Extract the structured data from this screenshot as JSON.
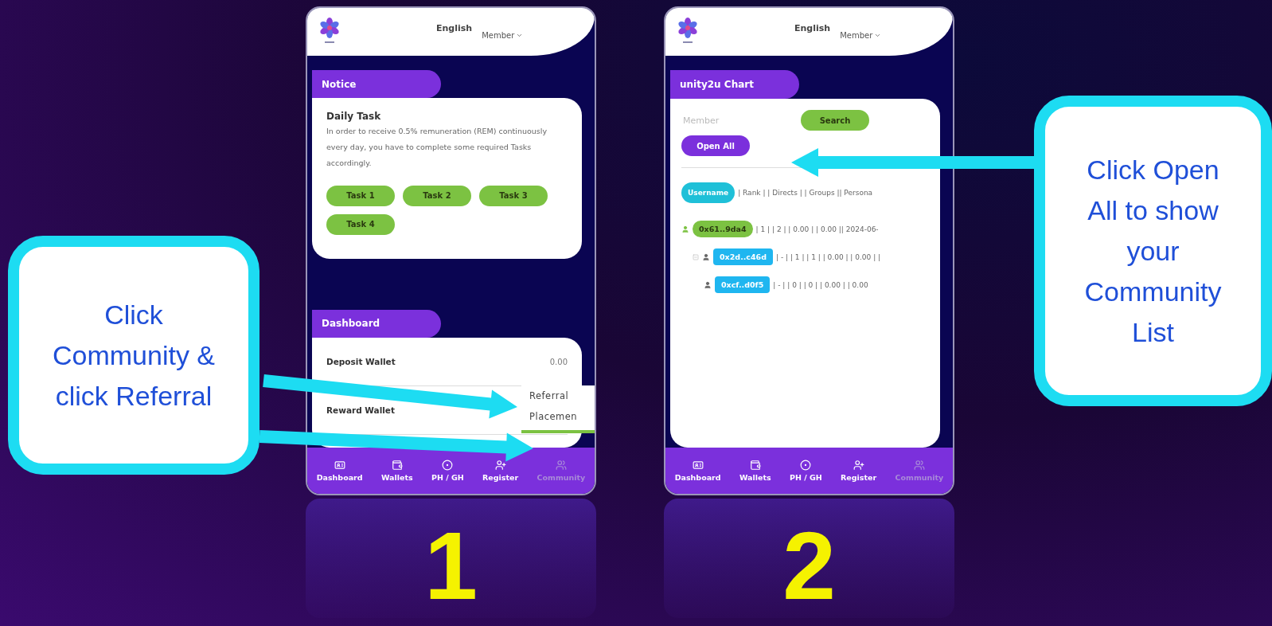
{
  "callouts": [
    {
      "text": "Click Community & click Referral"
    },
    {
      "text": "Click Open All to show your Community List"
    }
  ],
  "screens": [
    {
      "kind": "dashboard",
      "number": "1",
      "header": {
        "language": "English",
        "menu": "Member"
      },
      "notice": {
        "title": "Notice",
        "card_title": "Daily Task",
        "text": "In order to receive 0.5% remuneration (REM) continuously every day, you have to complete some required Tasks accordingly.",
        "tasks": [
          "Task 1",
          "Task 2",
          "Task 3",
          "Task 4"
        ]
      },
      "dashboard": {
        "title": "Dashboard",
        "rows": [
          {
            "label": "Deposit Wallet",
            "value": "0.00"
          },
          {
            "label": "Reward Wallet"
          }
        ]
      },
      "popup_menu": [
        "Referral",
        "Placemen"
      ],
      "nav": [
        {
          "label": "Dashboard",
          "selected": false
        },
        {
          "label": "Wallets",
          "selected": false
        },
        {
          "label": "PH / GH",
          "selected": false
        },
        {
          "label": "Register",
          "selected": false
        },
        {
          "label": "Community",
          "selected": true
        }
      ]
    },
    {
      "kind": "chart",
      "number": "2",
      "header": {
        "language": "English",
        "menu": "Member"
      },
      "chart": {
        "title": "unity2u Chart",
        "placeholder": "Member",
        "search": "Search",
        "open_all": "Open All",
        "header_pill": "Username",
        "header_columns": "| Rank | | Directs | | Groups || Persona",
        "tree": [
          {
            "id": "0x61..9da4",
            "color": "#7cc242",
            "stats": "| 1 | | 2 | | 0.00 | | 0.00 || 2024-06-",
            "children": [
              {
                "id": "0x2d..c46d",
                "color": "#1fb6f0",
                "stats": "| - | | 1 | | 1 | | 0.00 | | 0.00 | |",
                "children": [
                  {
                    "id": "0xcf..d0f5",
                    "color": "#1fb6f0",
                    "stats": "| - | | 0 | | 0 | | 0.00 | | 0.00"
                  }
                ]
              }
            ]
          }
        ]
      },
      "nav": [
        {
          "label": "Dashboard",
          "selected": false
        },
        {
          "label": "Wallets",
          "selected": false
        },
        {
          "label": "PH / GH",
          "selected": false
        },
        {
          "label": "Register",
          "selected": false
        },
        {
          "label": "Community",
          "selected": true
        }
      ]
    }
  ]
}
